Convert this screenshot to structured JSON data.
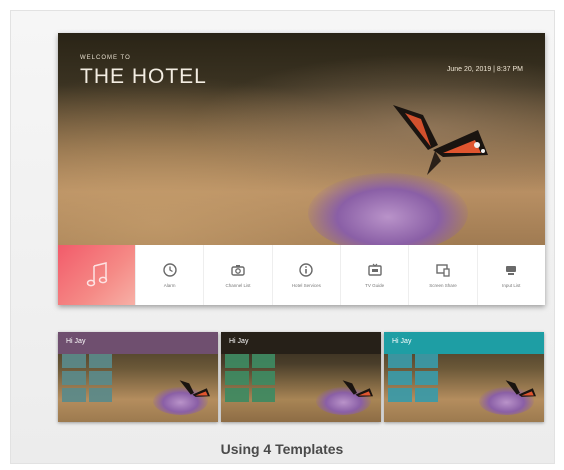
{
  "main_screen": {
    "welcome": "WELCOME TO",
    "title": "THE HOTEL",
    "datetime": "June 20, 2019 | 8:37 PM",
    "menu": [
      {
        "label": "Music",
        "icon": "music-note-icon"
      },
      {
        "label": "Alarm",
        "icon": "clock-icon"
      },
      {
        "label": "Channel List",
        "icon": "camera-icon"
      },
      {
        "label": "Hotel Services",
        "icon": "info-icon"
      },
      {
        "label": "TV Guide",
        "icon": "tv-guide-icon"
      },
      {
        "label": "Screen Share",
        "icon": "screen-share-icon"
      },
      {
        "label": "Input List",
        "icon": "input-list-icon"
      }
    ]
  },
  "templates": [
    {
      "header_text": "Hi Jay",
      "header_color": "#6f4f6f",
      "tile_color": "#5a8a8a"
    },
    {
      "header_text": "Hi Jay",
      "header_color": "#262018",
      "tile_color": "#3e8a62"
    },
    {
      "header_text": "Hi Jay",
      "header_color": "#1e9ea4",
      "tile_color": "#3a9aa8"
    }
  ],
  "caption": "Using 4 Templates",
  "colors": {
    "music_tile": "#f25b6a",
    "menu_background": "#ffffff",
    "icon_color": "#6a6a6a"
  }
}
